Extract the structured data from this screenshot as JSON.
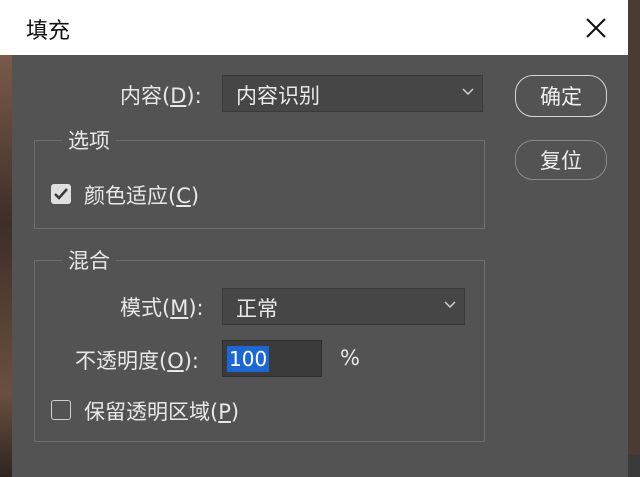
{
  "dialog": {
    "title": "填充",
    "close_icon": "close-icon"
  },
  "content": {
    "label_prefix": "内容(",
    "label_key": "D",
    "label_suffix": "):",
    "selected": "内容识别"
  },
  "buttons": {
    "ok": "确定",
    "reset": "复位"
  },
  "options_group": {
    "title": "选项",
    "color_adapt": {
      "label_prefix": "颜色适应(",
      "label_key": "C",
      "label_suffix": ")",
      "checked": true
    }
  },
  "blend_group": {
    "title": "混合",
    "mode": {
      "label_prefix": "模式(",
      "label_key": "M",
      "label_suffix": "):",
      "selected": "正常"
    },
    "opacity": {
      "label_prefix": "不透明度(",
      "label_key": "O",
      "label_suffix": "):",
      "value": "100",
      "unit": "%"
    },
    "preserve_transparency": {
      "label_prefix": "保留透明区域(",
      "label_key": "P",
      "label_suffix": ")",
      "checked": false
    }
  }
}
